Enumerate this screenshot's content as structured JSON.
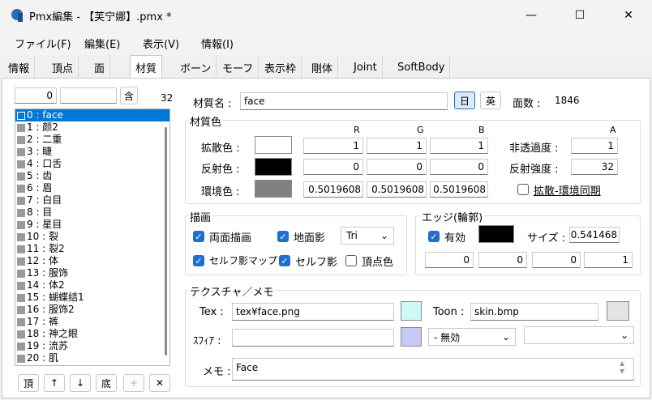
{
  "window": {
    "title": "Pmx編集 - 【芙宁娜】.pmx *",
    "minimize": "—",
    "maximize": "☐",
    "close": "✕"
  },
  "menu": [
    "ファイル(F)",
    "編集(E)",
    "表示(V)",
    "情報(I)"
  ],
  "tabs": [
    "情報",
    "頂点",
    "面",
    "材質",
    "ボーン",
    "モーフ",
    "表示枠",
    "剛体",
    "Joint",
    "SoftBody"
  ],
  "active_tab": "材質",
  "list_panel": {
    "index_value": "0",
    "search_value": "",
    "contains_button": "含",
    "count": "32",
    "items": [
      "0 : face",
      "1 : 颜2",
      "2 : 二重",
      "3 : 睫",
      "4 : 口舌",
      "5 : 齿",
      "6 : 眉",
      "7 : 白目",
      "8 : 目",
      "9 : 星目",
      "10 : 裂",
      "11 : 裂2",
      "12 : 体",
      "13 : 服饰",
      "14 : 体2",
      "15 : 蝴蝶结1",
      "16 : 服饰2",
      "17 : 裤",
      "18 : 神之眼",
      "19 : 流苏",
      "20 : 肌"
    ],
    "buttons": {
      "top": "頂",
      "up": "↑",
      "down": "↓",
      "bottom": "底",
      "add": "+",
      "delete": "✕"
    }
  },
  "material": {
    "name_label": "材質名 :",
    "name_value": "face",
    "jp_button": "日",
    "en_button": "英",
    "face_count_label": "面数 :",
    "face_count": "1846",
    "color_group": "材質色",
    "col_r": "R",
    "col_g": "G",
    "col_b": "B",
    "col_a": "A",
    "diffuse_label": "拡散色 :",
    "diffuse": [
      "1",
      "1",
      "1"
    ],
    "alpha_label": "非透過度 :",
    "alpha": "1",
    "specular_label": "反射色 :",
    "specular": [
      "0",
      "0",
      "0"
    ],
    "spec_power_label": "反射強度 :",
    "spec_power": "32",
    "ambient_label": "環境色 :",
    "ambient": [
      "0.5019608",
      "0.5019608",
      "0.5019608"
    ],
    "sync_label": "拡散-環境同期",
    "colors": {
      "diffuse": "#ffffff",
      "specular": "#000000",
      "ambient": "#808080",
      "edge": "#000000",
      "tex": "#cff8f8",
      "sphere": "#c8c8f4",
      "toon": "#e4e4e4",
      "accent": "#1f6fd1"
    }
  },
  "draw": {
    "group": "描画",
    "both_sides": "両面描画",
    "ground_shadow": "地面影",
    "primitive": "Tri",
    "self_shadow_map": "セルフ影マップ",
    "self_shadow": "セルフ影",
    "vertex_color": "頂点色"
  },
  "edge": {
    "group": "エッジ(輪郭)",
    "enabled": "有効",
    "size_label": "サイズ :",
    "size": "0.541468",
    "rgba": [
      "0",
      "0",
      "0",
      "1"
    ]
  },
  "texture": {
    "group": "テクスチャ／メモ",
    "tex_label": "Tex :",
    "tex_value": "tex¥face.png",
    "toon_label": "Toon :",
    "toon_value": "skin.bmp",
    "sphere_label": "ｽﾌｨｱ :",
    "sphere_value": "",
    "sphere_mode": "- 無効",
    "toon_select": "",
    "memo_label": "メモ :",
    "memo_value": "Face"
  }
}
